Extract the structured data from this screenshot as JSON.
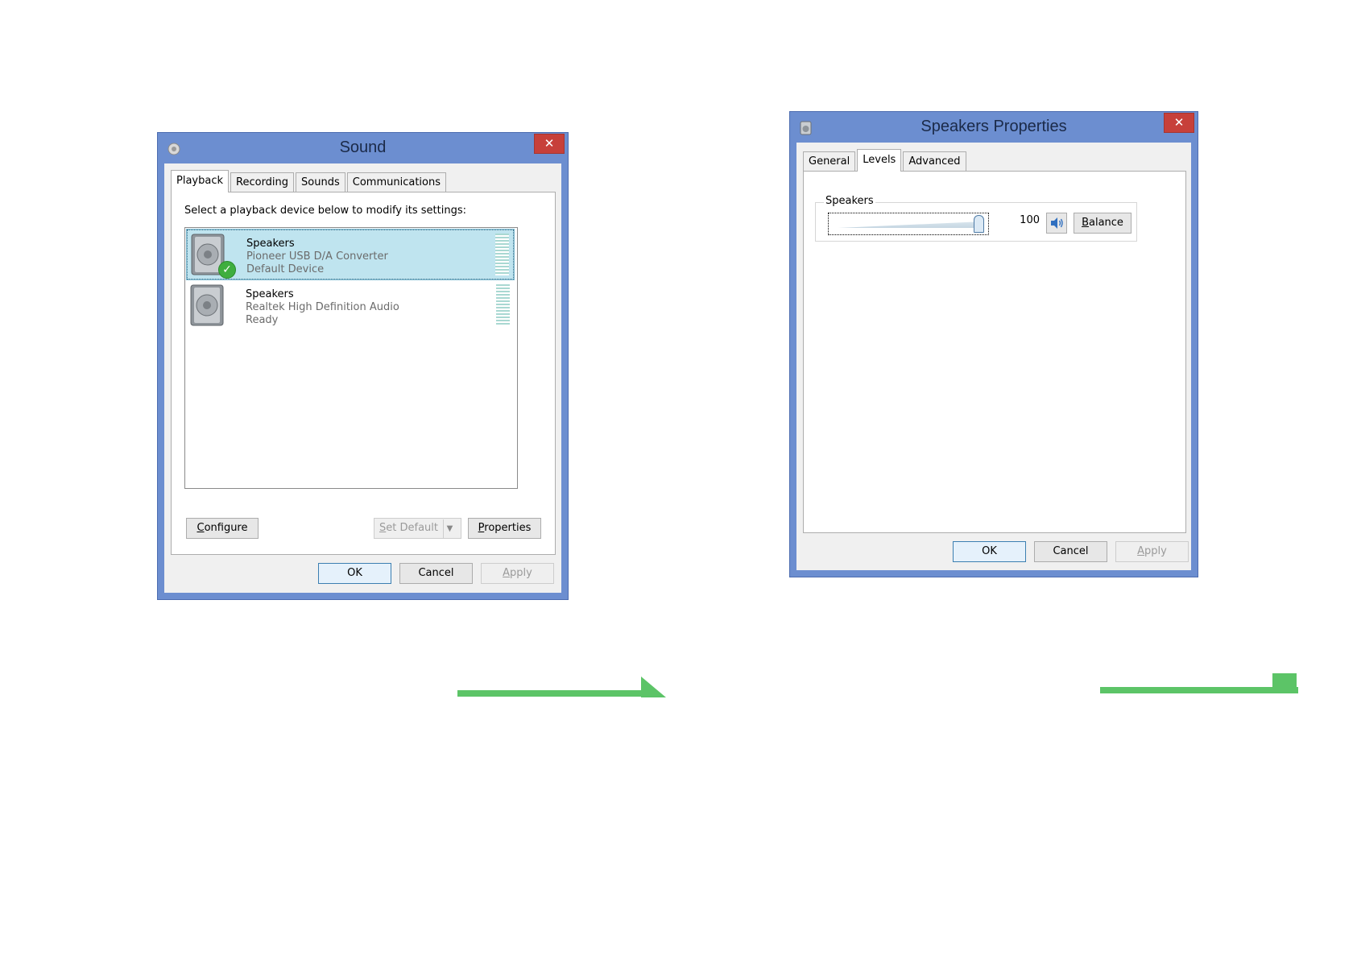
{
  "colors": {
    "title_bar": "#6c8ed0",
    "close_button": "#c7403a",
    "selection": "#bfe4ef",
    "meter": "#a9d8d2",
    "default_check": "#3fae3f",
    "arrow": "#5cc467"
  },
  "sound_dialog": {
    "title": "Sound",
    "close_glyph": "✕",
    "tabs": [
      {
        "label": "Playback",
        "active": true
      },
      {
        "label": "Recording",
        "active": false
      },
      {
        "label": "Sounds",
        "active": false
      },
      {
        "label": "Communications",
        "active": false
      }
    ],
    "instruction": "Select a playback device below to modify its settings:",
    "devices": [
      {
        "name": "Speakers",
        "description": "Pioneer USB D/A Converter",
        "status": "Default Device",
        "selected": true,
        "default": true,
        "icon": "speaker-icon"
      },
      {
        "name": "Speakers",
        "description": "Realtek High Definition Audio",
        "status": "Ready",
        "selected": false,
        "default": false,
        "icon": "speaker-icon"
      }
    ],
    "buttons": {
      "configure_u": "C",
      "configure_rest": "onfigure",
      "set_default_u": "S",
      "set_default_rest": "et Default",
      "properties_u": "P",
      "properties_rest": "roperties",
      "ok": "OK",
      "cancel": "Cancel",
      "apply_u": "A",
      "apply_rest": "pply"
    }
  },
  "properties_dialog": {
    "title": "Speakers Properties",
    "close_glyph": "✕",
    "tabs": [
      {
        "label": "General",
        "active": false
      },
      {
        "label": "Levels",
        "active": true
      },
      {
        "label": "Advanced",
        "active": false
      }
    ],
    "group_label": "Speakers",
    "volume": {
      "value": "100",
      "level": 1.0,
      "min": 0,
      "max": 100
    },
    "mute_icon": "speaker-volume-icon",
    "buttons": {
      "balance_u": "B",
      "balance_rest": "alance",
      "ok": "OK",
      "cancel": "Cancel",
      "apply_u": "A",
      "apply_rest": "pply"
    }
  }
}
